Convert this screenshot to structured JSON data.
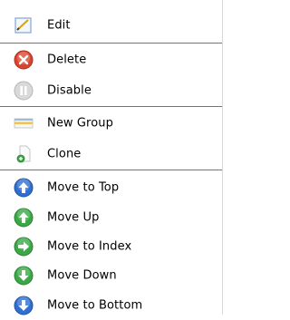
{
  "menu": {
    "items": [
      {
        "label": "Edit",
        "icon": "edit-icon"
      },
      {
        "label": "Delete",
        "icon": "delete-icon"
      },
      {
        "label": "Disable",
        "icon": "pause-icon"
      },
      {
        "label": "New Group",
        "icon": "new-group-icon"
      },
      {
        "label": "Clone",
        "icon": "clone-icon"
      },
      {
        "label": "Move to Top",
        "icon": "arrow-up-blue-icon"
      },
      {
        "label": "Move Up",
        "icon": "arrow-up-green-icon"
      },
      {
        "label": "Move to Index",
        "icon": "arrow-right-green-icon"
      },
      {
        "label": "Move Down",
        "icon": "arrow-down-green-icon"
      },
      {
        "label": "Move to Bottom",
        "icon": "arrow-down-blue-icon"
      }
    ]
  },
  "colors": {
    "separator": "#3a82c4",
    "delete_red": "#d9442e",
    "blue_arrow": "#2f6fd0",
    "green_arrow": "#3aa845",
    "disable_gray": "#b5b5b5"
  }
}
